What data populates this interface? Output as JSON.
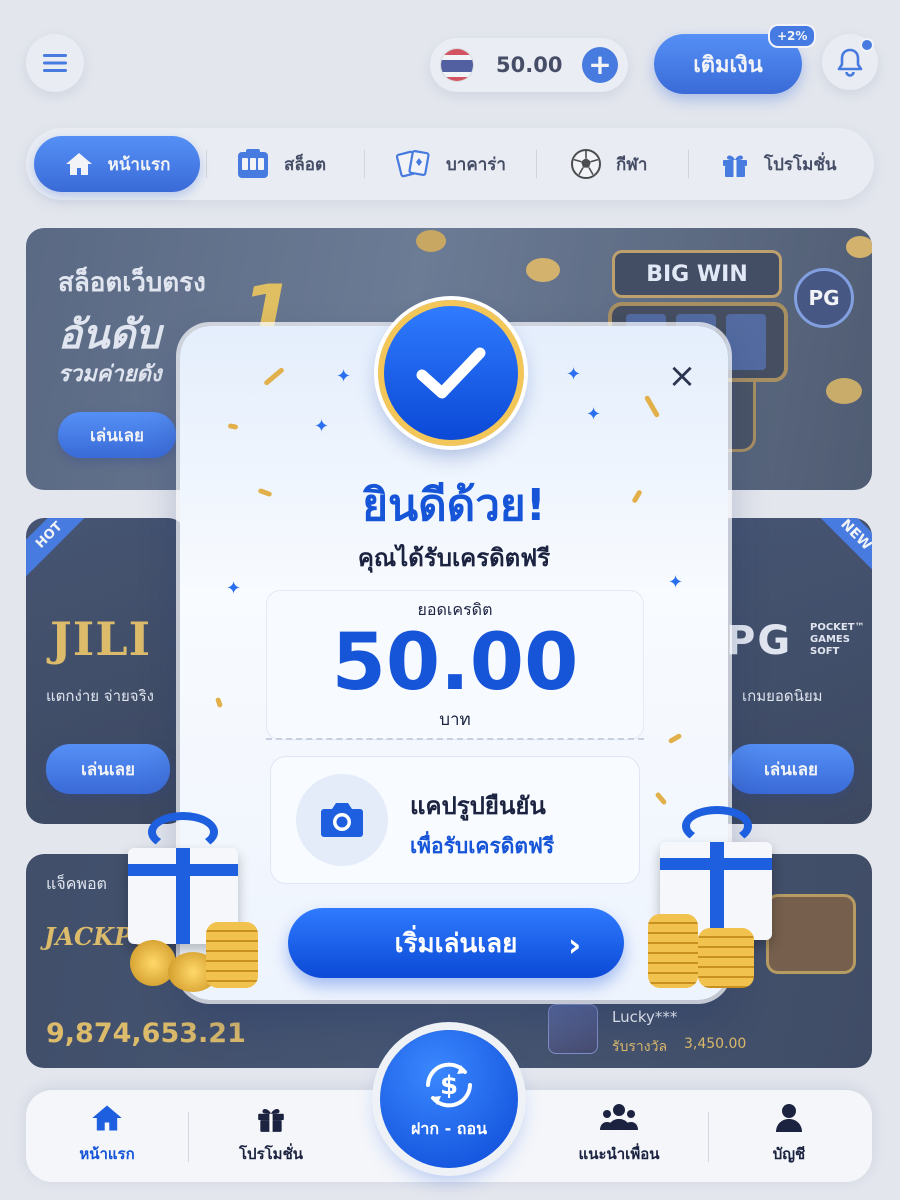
{
  "header": {
    "balance": "50.00",
    "deposit_label": "เติมเงิน",
    "deposit_badge": "+2%"
  },
  "nav": {
    "tabs": [
      {
        "label": "หน้าแรก",
        "icon": "home-icon",
        "active": true
      },
      {
        "label": "สล็อต",
        "icon": "slot-machine-icon"
      },
      {
        "label": "บาคาร่า",
        "icon": "cards-icon"
      },
      {
        "label": "กีฬา",
        "icon": "soccer-ball-icon"
      },
      {
        "label": "โปรโมชั่น",
        "icon": "gift-icon"
      }
    ]
  },
  "banner": {
    "line1": "สล็อตเว็บตรง",
    "line2": "อันดับ",
    "line3": "รวมค่ายดัง",
    "big_win": "BIG WIN",
    "provider_badge": "PG",
    "play_label": "เล่นเลย"
  },
  "cards": {
    "left": {
      "tag": "HOT",
      "logo": "JILI",
      "desc": "แตกง่าย จ่ายจริง",
      "play_label": "เล่นเลย"
    },
    "right": {
      "tag": "NEW",
      "logo": "PG",
      "logo_sub": "POCKET™ GAMES SOFT",
      "desc": "เกมยอดนิยม",
      "play_label": "เล่นเลย"
    }
  },
  "jackpot": {
    "label": "แจ็คพอต",
    "logo": "JACKPOT",
    "amount": "9,874,653.21",
    "winner_name": "Lucky***",
    "winner_label": "รับรางวัล",
    "winner_amount": "3,450.00"
  },
  "modal": {
    "title": "ยินดีด้วย!",
    "subtitle": "คุณได้รับเครดิตฟรี",
    "credit_label": "ยอดเครดิต",
    "credit_value": "50.00",
    "credit_unit": "บาท",
    "capture_line1": "แคปรูปยืนยัน",
    "capture_line2": "เพื่อรับเครดิตฟรี",
    "start_label": "เริ่มเล่นเลย",
    "close_label": "×"
  },
  "bottom_nav": {
    "items": [
      {
        "label": "หน้าแรก",
        "icon": "home-icon"
      },
      {
        "label": "โปรโมชั่น",
        "icon": "gift-icon"
      },
      {
        "label": "แนะนำเพื่อน",
        "icon": "users-icon"
      },
      {
        "label": "บัญชี",
        "icon": "user-icon"
      }
    ],
    "center_label": "ฝาก - ถอน"
  },
  "colors": {
    "primary": "#1654d8",
    "accent_gold": "#e3b546"
  }
}
